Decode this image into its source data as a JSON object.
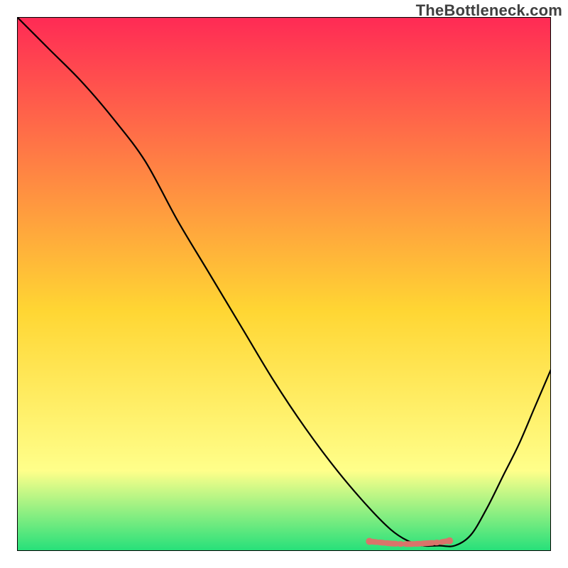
{
  "watermark": "TheBottleneck.com",
  "chart_data": {
    "type": "line",
    "title": "",
    "xlabel": "",
    "ylabel": "",
    "xlim": [
      0,
      100
    ],
    "ylim": [
      0,
      100
    ],
    "grid": false,
    "legend": false,
    "background_gradient": {
      "top_color": "#ff2a55",
      "mid_color": "#ffd633",
      "bottom_color": "#25e07a"
    },
    "series": [
      {
        "name": "curve",
        "type": "line",
        "color": "#000000",
        "x": [
          0,
          6,
          12,
          18,
          24,
          30,
          36,
          42,
          48,
          54,
          60,
          66,
          70,
          73,
          76,
          79,
          82,
          85,
          88,
          91,
          94,
          97,
          100
        ],
        "y": [
          100,
          94,
          88,
          81,
          73,
          62,
          52,
          42,
          32,
          23,
          15,
          8,
          4,
          2,
          1,
          1,
          1,
          3,
          8,
          14,
          20,
          27,
          34
        ]
      },
      {
        "name": "bottom-marker",
        "type": "scatter",
        "color": "#d9746a",
        "x": [
          66,
          68,
          70,
          72,
          74,
          76,
          79,
          81
        ],
        "y": [
          1.8,
          1.6,
          1.4,
          1.3,
          1.3,
          1.4,
          1.6,
          1.9
        ]
      }
    ]
  }
}
